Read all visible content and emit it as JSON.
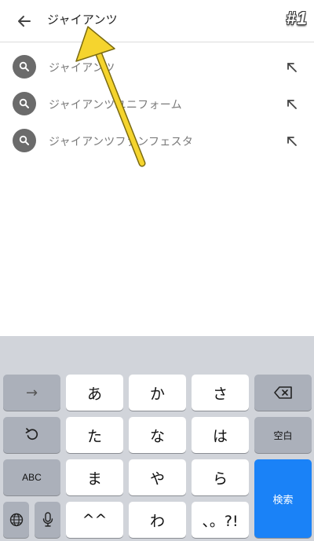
{
  "header": {
    "query": "ジャイアンツ",
    "badge": "#1"
  },
  "suggestions": [
    {
      "text": "ジャイアンツ"
    },
    {
      "text": "ジャイアンツユニフォーム"
    },
    {
      "text": "ジャイアンツファンフェスタ"
    }
  ],
  "keyboard": {
    "row1": {
      "arrow": "→",
      "k1": "あ",
      "k2": "か",
      "k3": "さ"
    },
    "row2": {
      "k1": "た",
      "k2": "な",
      "k3": "は",
      "space": "空白"
    },
    "row3": {
      "abc": "ABC",
      "k1": "ま",
      "k2": "や",
      "k3": "ら",
      "search": "検索"
    },
    "row4": {
      "k1": "^^",
      "k2": "わ",
      "k3": "、。?!"
    }
  },
  "colors": {
    "accent": "#1a82f7",
    "annotation": "#f5d42e"
  }
}
